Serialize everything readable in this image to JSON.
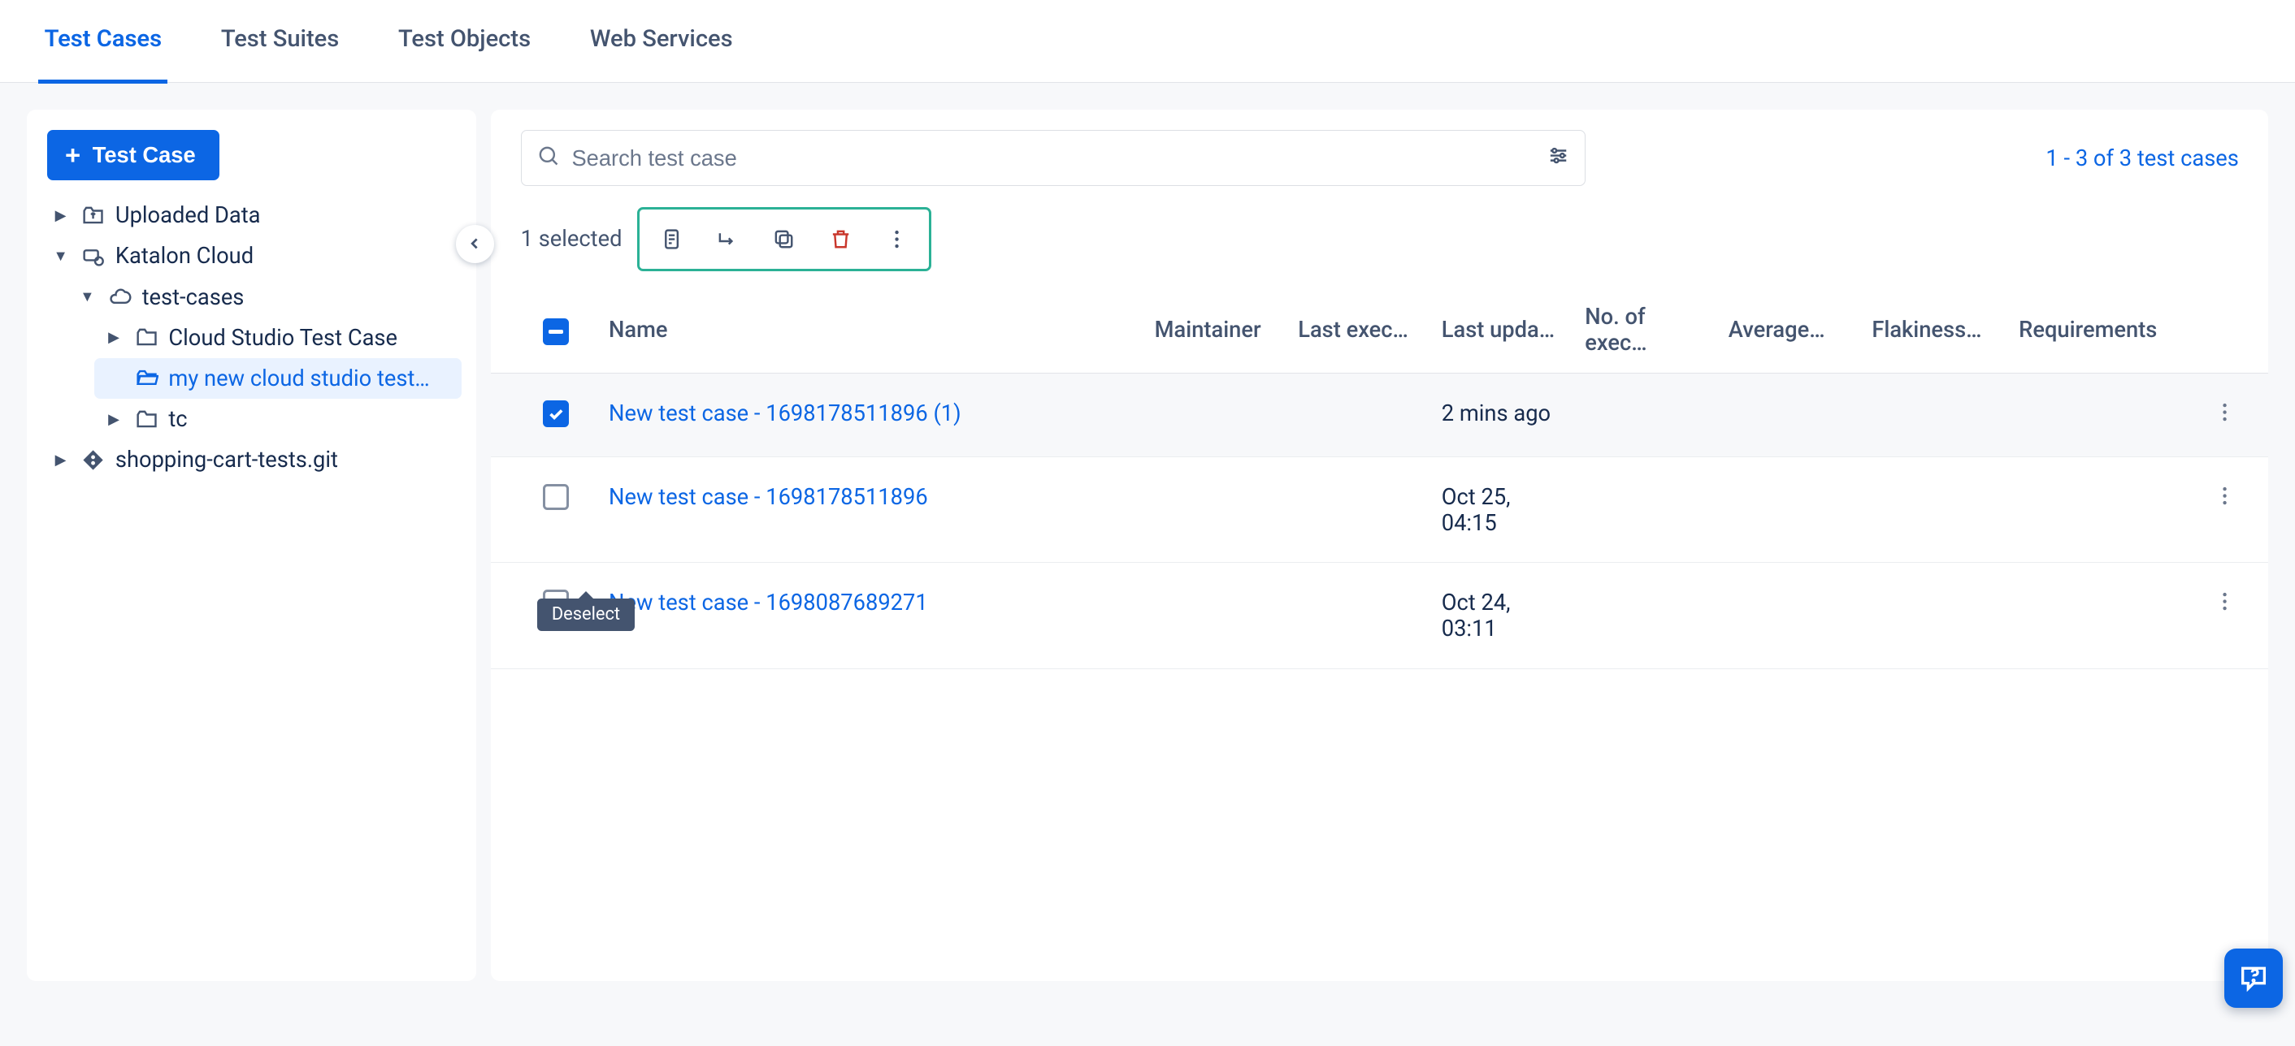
{
  "tabs": [
    "Test Cases",
    "Test Suites",
    "Test Objects",
    "Web Services"
  ],
  "active_tab": 0,
  "new_button": "Test Case",
  "tree": {
    "n0": "Uploaded Data",
    "n1": "Katalon Cloud",
    "n2": "test-cases",
    "n3": "Cloud Studio Test Case",
    "n4": "my new cloud studio test…",
    "n5": "tc",
    "n6": "shopping-cart-tests.git"
  },
  "search_placeholder": "Search test case",
  "count_text": "1 - 3 of 3 test cases",
  "selected_text": "1 selected",
  "tooltip": "Deselect",
  "columns": {
    "name": "Name",
    "maintainer": "Maintainer",
    "last_exec": "Last exec…",
    "last_upda": "Last upda…",
    "no_exec": "No. of exec…",
    "average": "Average…",
    "flakiness": "Flakiness…",
    "requirements": "Requirements"
  },
  "rows": [
    {
      "name": "New test case - 1698178511896 (1)",
      "last_upda": "2 mins ago",
      "checked": true
    },
    {
      "name": "New test case - 1698178511896",
      "last_upda": "Oct 25, 04:15",
      "checked": false
    },
    {
      "name": "New test case - 1698087689271",
      "last_upda": "Oct 24, 03:11",
      "checked": false
    }
  ]
}
